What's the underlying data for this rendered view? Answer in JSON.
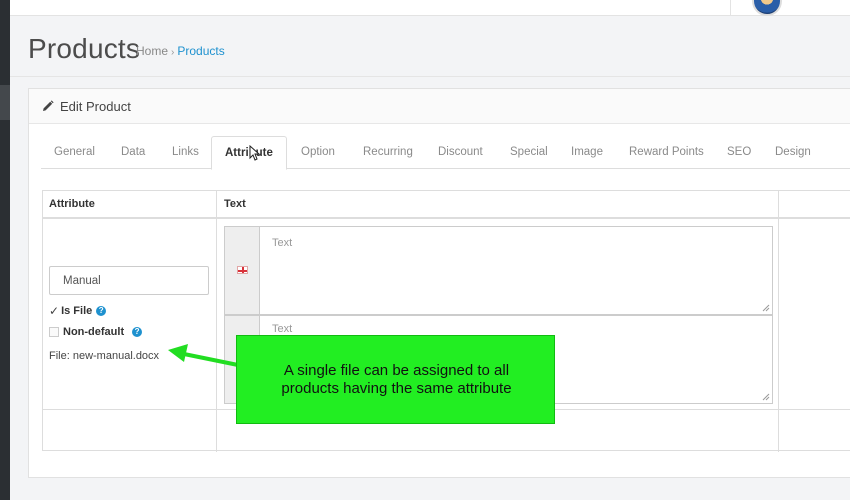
{
  "header": {
    "title": "Products",
    "breadcrumb": {
      "home": "Home",
      "separator": "›",
      "current": "Products"
    }
  },
  "panel": {
    "icon": "pencil-icon",
    "title": "Edit Product"
  },
  "tabs": [
    {
      "label": "General"
    },
    {
      "label": "Data"
    },
    {
      "label": "Links"
    },
    {
      "label": "Attribute",
      "active": true
    },
    {
      "label": "Option"
    },
    {
      "label": "Recurring"
    },
    {
      "label": "Discount"
    },
    {
      "label": "Special"
    },
    {
      "label": "Image"
    },
    {
      "label": "Reward Points"
    },
    {
      "label": "SEO"
    },
    {
      "label": "Design"
    }
  ],
  "attribute_table": {
    "headers": {
      "attribute": "Attribute",
      "text": "Text"
    },
    "row": {
      "attribute_value": "Manual",
      "is_file": {
        "label": "Is File",
        "checked": true
      },
      "non_default": {
        "label": "Non-default",
        "checked": false
      },
      "file_label": "File: new-manual.docx",
      "text_placeholder_1": "Text",
      "text_placeholder_2": "Text"
    }
  },
  "callout": {
    "line1": "A single file can be assigned to all",
    "line2": "products having the same attribute",
    "color": "#22ee22"
  },
  "colors": {
    "link": "#1e91cf",
    "sidebar": "#2b2f33"
  }
}
